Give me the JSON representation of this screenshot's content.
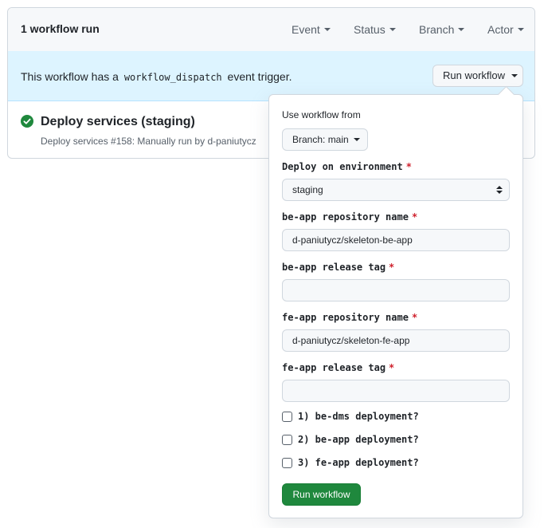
{
  "header": {
    "run_count": "1 workflow run",
    "filters": [
      {
        "label": "Event"
      },
      {
        "label": "Status"
      },
      {
        "label": "Branch"
      },
      {
        "label": "Actor"
      }
    ]
  },
  "banner": {
    "text_before": "This workflow has a",
    "code": "workflow_dispatch",
    "text_after": "event trigger.",
    "button_label": "Run workflow"
  },
  "run": {
    "status_icon": "check-circle-icon",
    "title": "Deploy services (staging)",
    "meta": "Deploy services #158: Manually run by d-paniutycz"
  },
  "dropdown": {
    "use_from_label": "Use workflow from",
    "branch_button": "Branch: main",
    "environment": {
      "label": "Deploy on environment",
      "required": "*",
      "value": "staging"
    },
    "be_repo": {
      "label": "be-app repository name",
      "required": "*",
      "value": "d-paniutycz/skeleton-be-app"
    },
    "be_tag": {
      "label": "be-app release tag",
      "required": "*",
      "value": ""
    },
    "fe_repo": {
      "label": "fe-app repository name",
      "required": "*",
      "value": "d-paniutycz/skeleton-fe-app"
    },
    "fe_tag": {
      "label": "fe-app release tag",
      "required": "*",
      "value": ""
    },
    "checkboxes": [
      {
        "label": "1) be-dms deployment?",
        "checked": false
      },
      {
        "label": "2) be-app deployment?",
        "checked": false
      },
      {
        "label": "3) fe-app deployment?",
        "checked": false
      }
    ],
    "submit_label": "Run workflow"
  },
  "colors": {
    "success_green": "#1f883d",
    "required_red": "#cf222e",
    "banner_blue": "#ddf4ff"
  }
}
